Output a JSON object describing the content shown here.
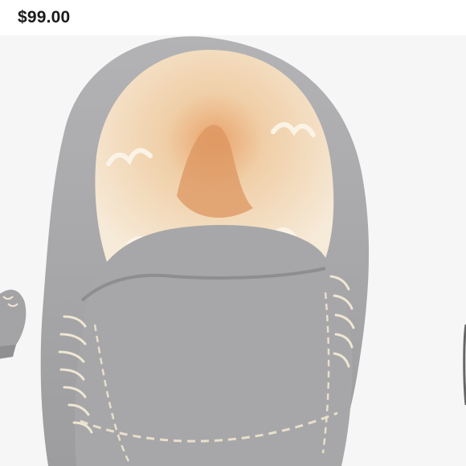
{
  "product": {
    "price": "$99.00"
  },
  "carousel": {
    "slides": [
      {
        "name": "previous-slide",
        "image": "slipper-side-icon"
      },
      {
        "name": "current-slide",
        "image": "slipper-toe-closeup-icon"
      },
      {
        "name": "next-slide",
        "image": "slipper-icon"
      }
    ]
  },
  "colors": {
    "suede": "#a9a9ab",
    "fur": "#f2e3cf",
    "fur_inner": "#e5a874",
    "stitch": "#efe6d4",
    "background": "#f6f6f6"
  }
}
